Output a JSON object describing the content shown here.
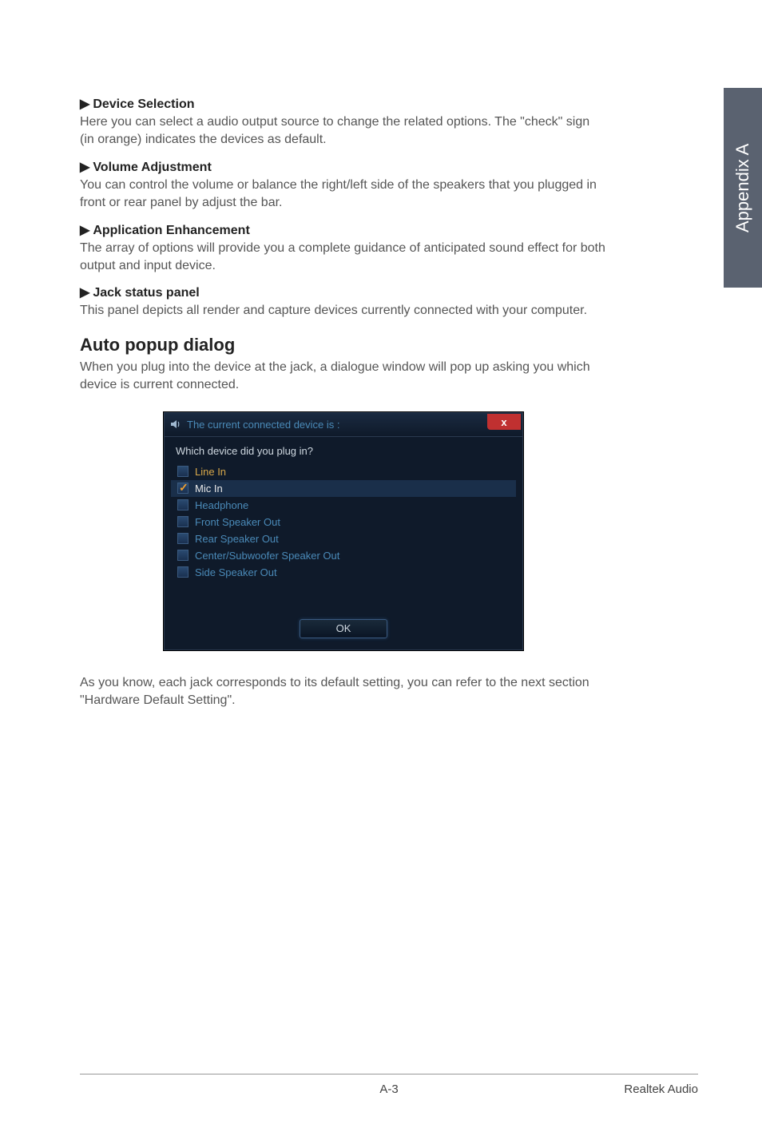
{
  "sideTab": "Appendix A",
  "sections": {
    "deviceSelection": {
      "heading": "Device Selection",
      "body": "Here you can select a audio output source to change the related options. The \"check\" sign (in orange) indicates the devices as default."
    },
    "volumeAdjustment": {
      "heading": "Volume Adjustment",
      "body": "You can control the volume or balance the right/left side of the speakers that you plugged in front or rear panel by adjust the bar."
    },
    "applicationEnhancement": {
      "heading": "Application Enhancement",
      "body": "The array of options will provide you a complete guidance of anticipated sound effect for both output and input device."
    },
    "jackStatus": {
      "heading": "Jack status panel",
      "body": "This panel depicts all render and capture devices currently connected with your computer."
    },
    "autoPopup": {
      "title": "Auto popup dialog",
      "body": "When you plug into the device at the jack, a dialogue window will pop up asking you which device is current connected."
    },
    "closingText": "As you know, each jack corresponds to its default setting, you can refer to the next section \"Hardware Default Setting\"."
  },
  "dialog": {
    "title": "The current connected device is :",
    "prompt": "Which device did you plug in?",
    "closeGlyph": "x",
    "devices": [
      {
        "label": "Line In",
        "checked": false,
        "selected": false,
        "style": "normal"
      },
      {
        "label": "Mic In",
        "checked": true,
        "selected": true,
        "style": "white"
      },
      {
        "label": "Headphone",
        "checked": false,
        "selected": false,
        "style": "blue"
      },
      {
        "label": "Front Speaker Out",
        "checked": false,
        "selected": false,
        "style": "blue"
      },
      {
        "label": "Rear Speaker Out",
        "checked": false,
        "selected": false,
        "style": "blue"
      },
      {
        "label": "Center/Subwoofer Speaker Out",
        "checked": false,
        "selected": false,
        "style": "blue"
      },
      {
        "label": "Side Speaker Out",
        "checked": false,
        "selected": false,
        "style": "blue"
      }
    ],
    "okLabel": "OK"
  },
  "footer": {
    "pageNum": "A-3",
    "right": "Realtek Audio"
  }
}
